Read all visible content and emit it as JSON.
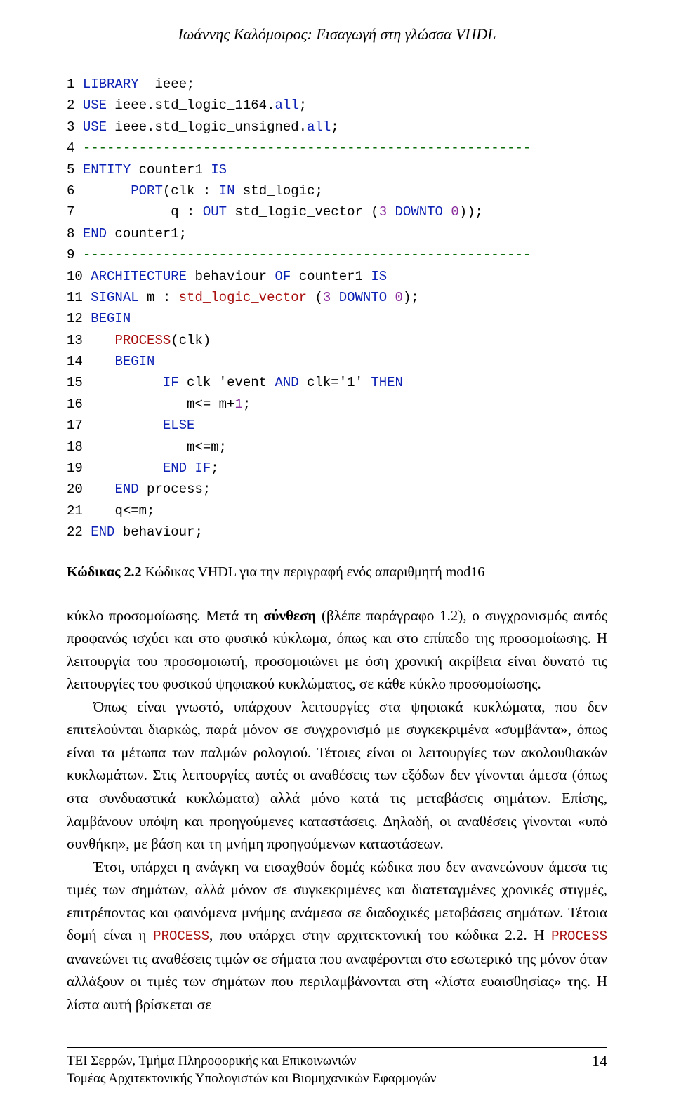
{
  "header": {
    "running_head": "Ιωάννης Καλόμοιρος: Εισαγωγή στη γλώσσα VHDL"
  },
  "code": {
    "lines": [
      {
        "n": "1",
        "pre": "",
        "parts": [
          {
            "cls": "kw-blue",
            "t": "LIBRARY"
          },
          {
            "cls": "kw-black",
            "t": "  ieee;"
          }
        ]
      },
      {
        "n": "2",
        "pre": "",
        "parts": [
          {
            "cls": "kw-blue",
            "t": "USE"
          },
          {
            "cls": "kw-black",
            "t": " ieee.std_logic_1164."
          },
          {
            "cls": "kw-blue",
            "t": "all"
          },
          {
            "cls": "kw-black",
            "t": ";"
          }
        ]
      },
      {
        "n": "3",
        "pre": "",
        "parts": [
          {
            "cls": "kw-blue",
            "t": "USE"
          },
          {
            "cls": "kw-black",
            "t": " ieee.std_logic_unsigned."
          },
          {
            "cls": "kw-blue",
            "t": "all"
          },
          {
            "cls": "kw-black",
            "t": ";"
          }
        ]
      },
      {
        "n": "4",
        "pre": "",
        "parts": [
          {
            "cls": "dashes",
            "t": "--------------------------------------------------------"
          }
        ]
      },
      {
        "n": "5",
        "pre": "",
        "parts": [
          {
            "cls": "kw-blue",
            "t": "ENTITY"
          },
          {
            "cls": "kw-black",
            "t": " counter1 "
          },
          {
            "cls": "kw-blue",
            "t": "IS"
          }
        ]
      },
      {
        "n": "6",
        "pre": "      ",
        "parts": [
          {
            "cls": "kw-blue",
            "t": "PORT"
          },
          {
            "cls": "kw-black",
            "t": "(clk : "
          },
          {
            "cls": "kw-blue",
            "t": "IN"
          },
          {
            "cls": "kw-black",
            "t": " std_logic;"
          }
        ]
      },
      {
        "n": "7",
        "pre": "           ",
        "parts": [
          {
            "cls": "kw-black",
            "t": "q : "
          },
          {
            "cls": "kw-blue",
            "t": "OUT"
          },
          {
            "cls": "kw-black",
            "t": " std_logic_vector ("
          },
          {
            "cls": "num-lit",
            "t": "3"
          },
          {
            "cls": "kw-black",
            "t": " "
          },
          {
            "cls": "kw-blue",
            "t": "DOWNTO"
          },
          {
            "cls": "kw-black",
            "t": " "
          },
          {
            "cls": "num-lit",
            "t": "0"
          },
          {
            "cls": "kw-black",
            "t": "));"
          }
        ]
      },
      {
        "n": "8",
        "pre": "",
        "parts": [
          {
            "cls": "kw-blue",
            "t": "END"
          },
          {
            "cls": "kw-black",
            "t": " counter1;"
          }
        ]
      },
      {
        "n": "9",
        "pre": "",
        "parts": [
          {
            "cls": "dashes",
            "t": "--------------------------------------------------------"
          }
        ]
      },
      {
        "n": "10",
        "pre": "",
        "parts": [
          {
            "cls": "kw-blue",
            "t": "ARCHITECTURE"
          },
          {
            "cls": "kw-black",
            "t": " behaviour "
          },
          {
            "cls": "kw-blue",
            "t": "OF"
          },
          {
            "cls": "kw-black",
            "t": " counter1 "
          },
          {
            "cls": "kw-blue",
            "t": "IS"
          }
        ]
      },
      {
        "n": "11",
        "pre": "",
        "parts": [
          {
            "cls": "kw-blue",
            "t": "SIGNAL"
          },
          {
            "cls": "kw-black",
            "t": " m : "
          },
          {
            "cls": "kw-red",
            "t": "std_logic_vector"
          },
          {
            "cls": "kw-black",
            "t": " ("
          },
          {
            "cls": "num-lit",
            "t": "3"
          },
          {
            "cls": "kw-black",
            "t": " "
          },
          {
            "cls": "kw-blue",
            "t": "DOWNTO"
          },
          {
            "cls": "kw-black",
            "t": " "
          },
          {
            "cls": "num-lit",
            "t": "0"
          },
          {
            "cls": "kw-black",
            "t": ");"
          }
        ]
      },
      {
        "n": "12",
        "pre": "",
        "parts": [
          {
            "cls": "kw-blue",
            "t": "BEGIN"
          }
        ]
      },
      {
        "n": "13",
        "pre": "   ",
        "parts": [
          {
            "cls": "kw-red",
            "t": "PROCESS"
          },
          {
            "cls": "kw-black",
            "t": "(clk)"
          }
        ]
      },
      {
        "n": "14",
        "pre": "   ",
        "parts": [
          {
            "cls": "kw-blue",
            "t": "BEGIN"
          }
        ]
      },
      {
        "n": "15",
        "pre": "         ",
        "parts": [
          {
            "cls": "kw-blue",
            "t": "IF"
          },
          {
            "cls": "kw-black",
            "t": " clk 'event "
          },
          {
            "cls": "kw-blue",
            "t": "AND"
          },
          {
            "cls": "kw-black",
            "t": " clk='1' "
          },
          {
            "cls": "kw-blue",
            "t": "THEN"
          }
        ]
      },
      {
        "n": "16",
        "pre": "            ",
        "parts": [
          {
            "cls": "kw-black",
            "t": "m<= m+"
          },
          {
            "cls": "num-lit",
            "t": "1"
          },
          {
            "cls": "kw-black",
            "t": ";"
          }
        ]
      },
      {
        "n": "17",
        "pre": "         ",
        "parts": [
          {
            "cls": "kw-blue",
            "t": "ELSE"
          }
        ]
      },
      {
        "n": "18",
        "pre": "            ",
        "parts": [
          {
            "cls": "kw-black",
            "t": "m<=m;"
          }
        ]
      },
      {
        "n": "19",
        "pre": "         ",
        "parts": [
          {
            "cls": "kw-blue",
            "t": "END IF"
          },
          {
            "cls": "kw-black",
            "t": ";"
          }
        ]
      },
      {
        "n": "20",
        "pre": "   ",
        "parts": [
          {
            "cls": "kw-blue",
            "t": "END"
          },
          {
            "cls": "kw-black",
            "t": " process;"
          }
        ]
      },
      {
        "n": "21",
        "pre": "   ",
        "parts": [
          {
            "cls": "kw-black",
            "t": "q<=m;"
          }
        ]
      },
      {
        "n": "22",
        "pre": "",
        "parts": [
          {
            "cls": "kw-blue",
            "t": "END"
          },
          {
            "cls": "kw-black",
            "t": " behaviour;"
          }
        ]
      }
    ]
  },
  "caption": {
    "label": "Κώδικας 2.2",
    "text": " Κώδικας VHDL για την περιγραφή ενός απαριθμητή mod16"
  },
  "body": {
    "p1_a": "κύκλο προσομοίωσης. Μετά τη ",
    "p1_b_bold": "σύνθεση",
    "p1_c": " (βλέπε παράγραφο 1.2), ο συγχρονισμός αυτός προφανώς ισχύει και στο φυσικό κύκλωμα, όπως και στο επίπεδο της προσομοίωσης. Η λειτουργία του προσομοιωτή, προσομοιώνει με όση χρονική ακρίβεια είναι δυνατό τις λειτουργίες του φυσικού ψηφιακού κυκλώματος, σε κάθε κύκλο προσομοίωσης.",
    "p2": "Όπως είναι γνωστό, υπάρχουν λειτουργίες στα ψηφιακά κυκλώματα, που δεν επιτελούνται διαρκώς, παρά μόνον σε συγχρονισμό με συγκεκριμένα «συμβάντα», όπως είναι τα μέτωπα των παλμών ρολογιού. Τέτοιες είναι οι λειτουργίες των ακολουθιακών κυκλωμάτων. Στις λειτουργίες αυτές οι αναθέσεις των εξόδων δεν γίνονται άμεσα (όπως στα συνδυαστικά κυκλώματα) αλλά μόνο κατά τις μεταβάσεις σημάτων. Επίσης, λαμβάνουν υπόψη και προηγούμενες καταστάσεις. Δηλαδή, οι αναθέσεις γίνονται «υπό συνθήκη», με βάση και τη μνήμη προηγούμενων καταστάσεων.",
    "p3_a": "Έτσι, υπάρχει η ανάγκη να εισαχθούν δομές κώδικα που δεν ανανεώνουν άμεσα τις τιμές των σημάτων, αλλά μόνον σε συγκεκριμένες και διατεταγμένες χρονικές στιγμές, επιτρέποντας και φαινόμενα μνήμης ανάμεσα σε διαδοχικές μεταβάσεις σημάτων. Τέτοια δομή είναι η ",
    "p3_m1": "PROCESS",
    "p3_b": ", που υπάρχει στην αρχιτεκτονική του κώδικα 2.2. Η ",
    "p3_m2": "PROCESS",
    "p3_c": " ανανεώνει τις αναθέσεις τιμών σε σήματα που αναφέρονται στο εσωτερικό της μόνον όταν αλλάξουν οι τιμές των σημάτων που περιλαμβάνονται στη «λίστα ευαισθησίας» της. Η λίστα αυτή βρίσκεται σε"
  },
  "footer": {
    "line1": "ΤΕΙ Σερρών, Τμήμα Πληροφορικής και Επικοινωνιών",
    "line2": "Τομέας Αρχιτεκτονικής Υπολογιστών και Βιομηχανικών Εφαρμογών",
    "page": "14"
  }
}
